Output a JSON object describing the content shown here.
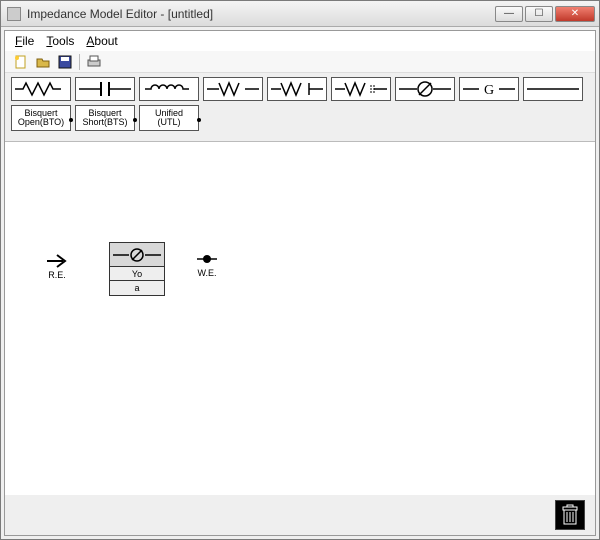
{
  "window": {
    "title": "Impedance Model Editor - [untitled]"
  },
  "menu": {
    "file": "File",
    "tools": "Tools",
    "about": "About"
  },
  "toolbar": {
    "new": "new",
    "open": "open",
    "save": "save",
    "print": "print"
  },
  "palette_text": {
    "bto_line1": "Bisquert",
    "bto_line2": "Open(BTO)",
    "bts_line1": "Bisquert",
    "bts_line2": "Short(BTS)",
    "utl_line1": "Unified",
    "utl_line2": "(UTL)"
  },
  "canvas": {
    "re_label": "R.E.",
    "we_label": "W.E.",
    "element": {
      "param1": "Yo",
      "param2": "a"
    }
  }
}
